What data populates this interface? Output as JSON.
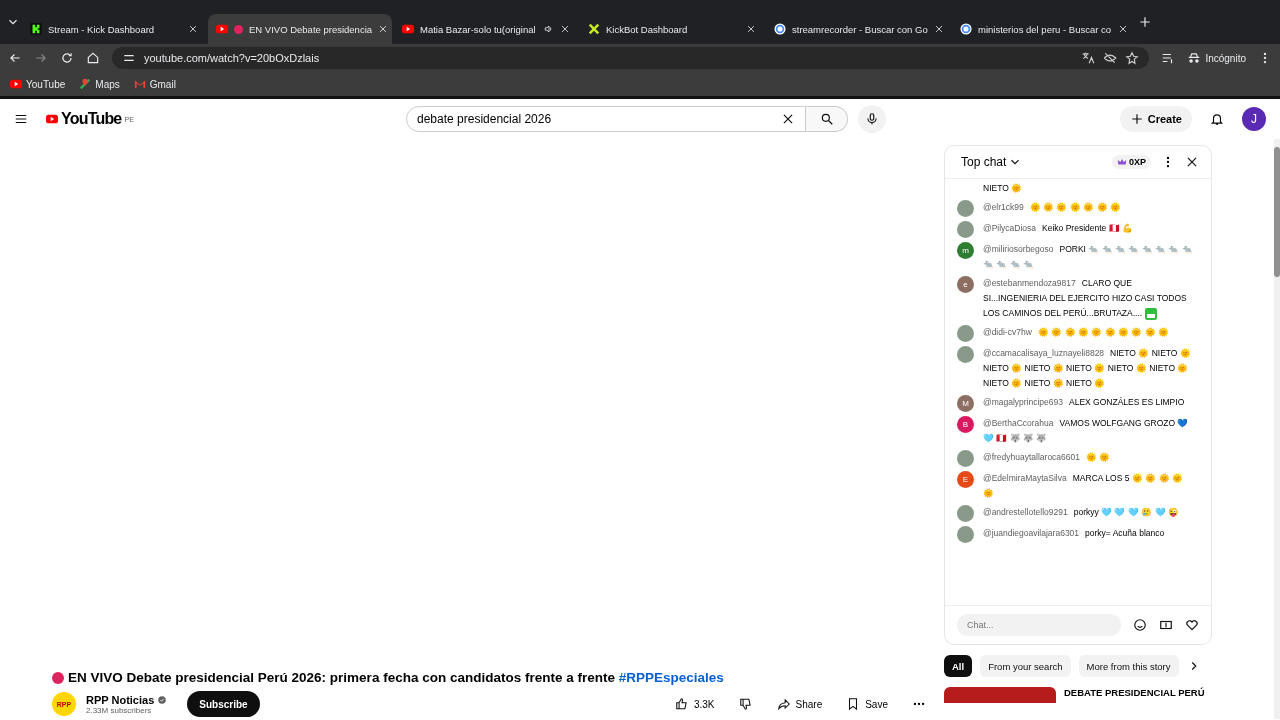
{
  "browser": {
    "tabs": [
      {
        "title": "Stream - Kick Dashboard",
        "kind": "kick",
        "selected": false,
        "audio": false
      },
      {
        "title": "EN VIVO Debate presidencia",
        "kind": "youtube",
        "selected": true,
        "audio": false
      },
      {
        "title": "Matia Bazar-solo tu(original",
        "kind": "youtube",
        "selected": false,
        "audio": true
      },
      {
        "title": "KickBot Dashboard",
        "kind": "kickbot",
        "selected": false,
        "audio": false
      },
      {
        "title": "streamrecorder - Buscar con Go",
        "kind": "google",
        "selected": false,
        "audio": false
      },
      {
        "title": "ministerios del peru - Buscar co",
        "kind": "google",
        "selected": false,
        "audio": false
      }
    ],
    "address": "youtube.com/watch?v=20bOxDzlais",
    "profile": "Incógnito",
    "bookmarks": [
      {
        "label": "YouTube",
        "kind": "youtube"
      },
      {
        "label": "Maps",
        "kind": "maps"
      },
      {
        "label": "Gmail",
        "kind": "gmail"
      }
    ]
  },
  "header": {
    "logo": "YouTube",
    "country": "PE",
    "search": "debate presidencial 2026",
    "create": "Create",
    "avatar": "J"
  },
  "chat": {
    "title": "Top chat",
    "xp": "0XP",
    "messages": [
      {
        "text": "NIETO 🌞"
      },
      {
        "author": "@elr1ck99",
        "kind": "photo",
        "text": "🌞 🌞 🌞 🌞 🌞 🌞 🌞"
      },
      {
        "author": "@PilycaDiosa",
        "kind": "photo",
        "text": "Keiko Presidente 🇵🇪 💪"
      },
      {
        "author": "@miliriosorbegoso",
        "kind": "letter",
        "letter": "m",
        "color": "#2e7d32",
        "text": "PORKI 🐀 🐀 🐀 🐀 🐀 🐀 🐀 🐀 🐀 🐀 🐀 🐀"
      },
      {
        "author": "@estebanmendoza9817",
        "kind": "letter",
        "letter": "e",
        "color": "#8d6e63",
        "text": "CLARO QUE SI...INGENIERIA DEL EJERCITO HIZO CASI TODOS LOS CAMINOS DEL PERÚ...BRUTAZA....",
        "emote": true
      },
      {
        "author": "@didi-cv7hw",
        "kind": "photo",
        "text": "🌞 🌞 🌞 🌞 🌞 🌞 🌞 🌞 🌞 🌞"
      },
      {
        "author": "@ccamacalisaya_luznayeli8828",
        "kind": "photo",
        "text": "NIETO 🌞 NIETO 🌞 NIETO 🌞 NIETO 🌞 NIETO 🌞 NIETO 🌞 NIETO 🌞 NIETO 🌞 NIETO 🌞 NIETO 🌞"
      },
      {
        "author": "@magalyprincipe693",
        "kind": "letter",
        "letter": "M",
        "color": "#8d6e63",
        "text": "ALEX GONZÁLES ES LIMPIO"
      },
      {
        "author": "@BerthaCcorahua",
        "kind": "letter",
        "letter": "B",
        "color": "#d81b60",
        "text": "VAMOS WOLFGANG GROZO 💙 🩵 🇵🇪 🐺 🐺 🐺"
      },
      {
        "author": "@fredyhuaytallaroca6601",
        "kind": "photo",
        "text": "🌞 🌞"
      },
      {
        "author": "@EdelmiraMaytaSilva",
        "kind": "letter",
        "letter": "E",
        "color": "#e64a19",
        "text": "MARCA LOS 5 🌞 🌞 🌞 🌞 🌞"
      },
      {
        "author": "@andrestellotello9291",
        "kind": "photo",
        "text": "porkyy 🩵 🩵 🩵 🥲 🩵 😜"
      },
      {
        "author": "@juandiegoavilajara6301",
        "kind": "photo",
        "text": "porky= Acuña blanco"
      }
    ],
    "placeholder": "Chat..."
  },
  "chips": [
    {
      "label": "All",
      "selected": true
    },
    {
      "label": "From your search",
      "selected": false
    },
    {
      "label": "More from this story",
      "selected": false
    }
  ],
  "recommendation": {
    "title": "DEBATE PRESIDENCIAL PERÚ"
  },
  "video": {
    "title": "EN VIVO Debate presidencial Perú 2026: primera fecha con candidatos frente a frente",
    "hashtag": "#RPPEspeciales",
    "channel": "RPP Noticias",
    "channel_logo": "RPP",
    "verified": true,
    "subscribers": "2.33M subscribers",
    "subscribe": "Subscribe",
    "likes": "3.3K",
    "share": "Share",
    "save": "Save"
  }
}
